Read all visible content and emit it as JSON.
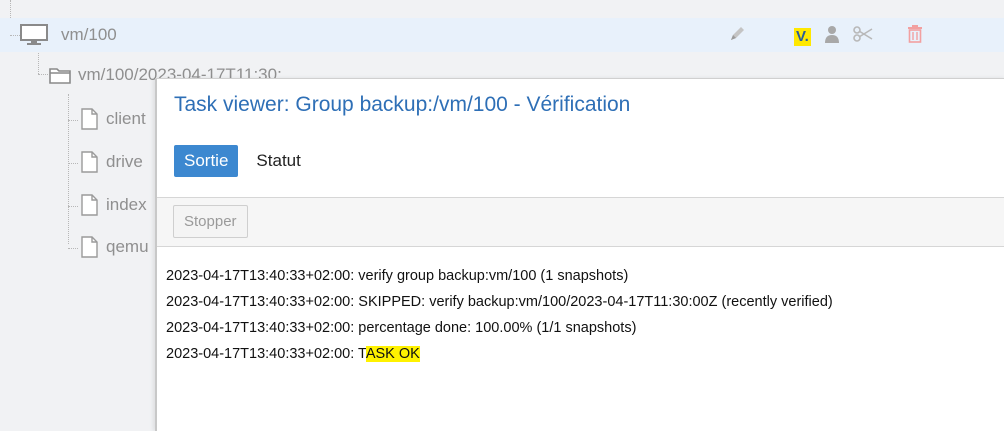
{
  "tree": {
    "vm_label": "vm/100",
    "group_label": "vm/100/2023-04-17T11:30:...",
    "files": [
      "client",
      "drive",
      "index",
      "qemu"
    ],
    "vm_badge": "V."
  },
  "modal": {
    "title": "Task viewer: Group backup:/vm/100 - Vérification",
    "tabs": [
      {
        "label": "Sortie",
        "active": true
      },
      {
        "label": "Statut",
        "active": false
      }
    ],
    "stop_label": "Stopper",
    "log_lines": [
      "2023-04-17T13:40:33+02:00: verify group backup:vm/100 (1 snapshots)",
      "2023-04-17T13:40:33+02:00: SKIPPED: verify backup:vm/100/2023-04-17T11:30:00Z (recently verified)",
      "2023-04-17T13:40:33+02:00: percentage done: 100.00% (1/1 snapshots)"
    ],
    "last_line_prefix": "2023-04-17T13:40:33+02:00: T",
    "last_line_highlight": "ASK OK"
  },
  "colors": {
    "accent": "#3c88d0",
    "title": "#2e6fb6",
    "highlight": "#fff200",
    "selected_row": "#e8f1fb"
  },
  "icons": [
    "monitor-icon",
    "folder-icon",
    "file-icon",
    "pencil-icon",
    "user-icon",
    "scissors-icon",
    "trash-icon"
  ]
}
